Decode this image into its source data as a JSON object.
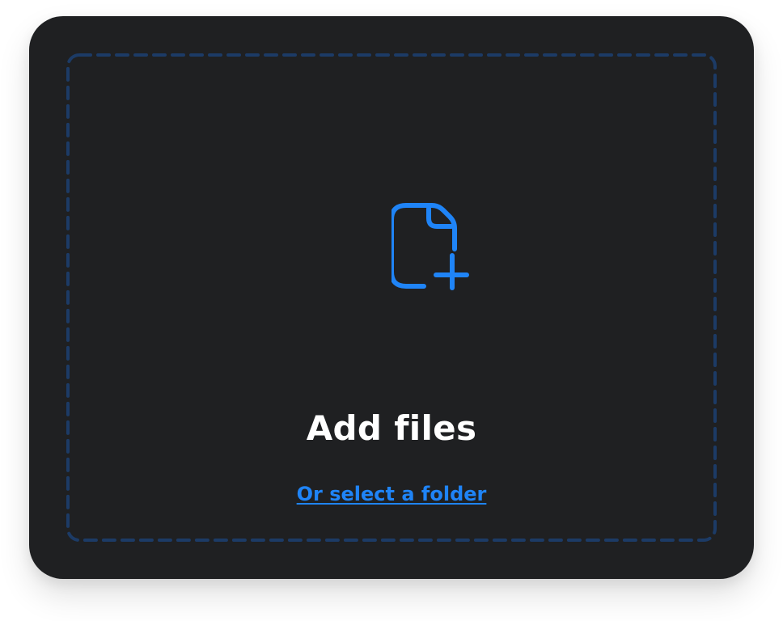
{
  "dropzone": {
    "icon": "file-plus-icon",
    "title": "Add files",
    "folder_link": "Or select a folder"
  },
  "colors": {
    "background": "#ffffff",
    "card": "#1f2022",
    "accent": "#1f84f7",
    "dashed_border": "#1c3b66",
    "title": "#ffffff"
  }
}
